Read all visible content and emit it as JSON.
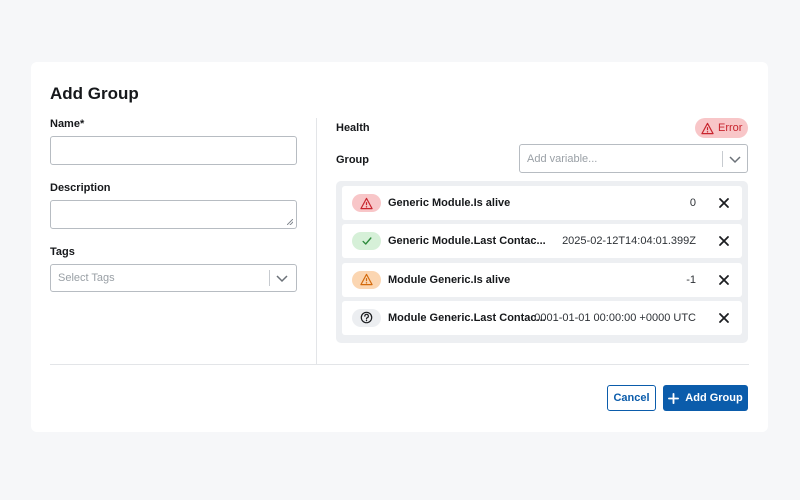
{
  "dialog": {
    "title": "Add Group"
  },
  "form": {
    "name": {
      "label": "Name*",
      "value": ""
    },
    "description": {
      "label": "Description",
      "value": ""
    },
    "tags": {
      "label": "Tags",
      "placeholder": "Select Tags"
    }
  },
  "health": {
    "label": "Health",
    "status": "Error",
    "status_color": "#c8242e"
  },
  "group": {
    "label": "Group",
    "placeholder": "Add variable..."
  },
  "variables": [
    {
      "status": "error",
      "icon": "warning-icon",
      "name": "Generic Module.Is alive",
      "value": "0"
    },
    {
      "status": "ok",
      "icon": "check-icon",
      "name": "Generic Module.Last Contac...",
      "value": "2025-02-12T14:04:01.399Z"
    },
    {
      "status": "warning",
      "icon": "warning-icon",
      "name": "Module Generic.Is alive",
      "value": "-1"
    },
    {
      "status": "unknown",
      "icon": "question-icon",
      "name": "Module Generic.Last Contac...",
      "value": "0001-01-01 00:00:00 +0000 UTC"
    }
  ],
  "actions": {
    "cancel_label": "Cancel",
    "add_label": "Add Group"
  },
  "colors": {
    "primary": "#0b5cab",
    "error": "#c8242e",
    "success": "#2e8b3d",
    "warning": "#d36a0c"
  }
}
